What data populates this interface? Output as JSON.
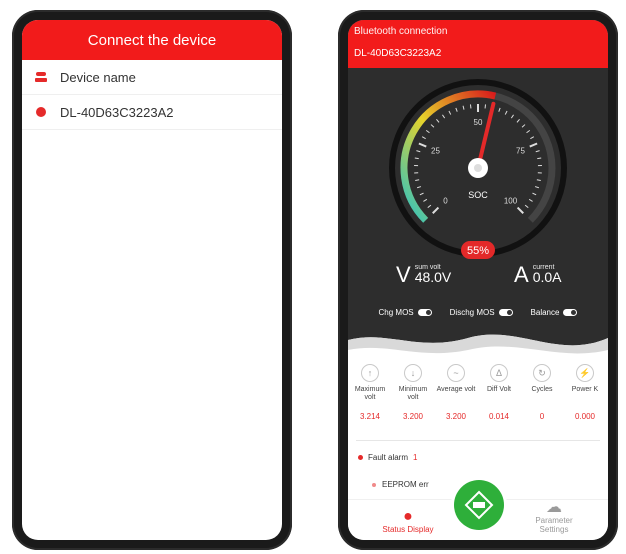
{
  "left_screen": {
    "title": "Connect the device",
    "header_row": {
      "label": "Device name"
    },
    "devices": [
      {
        "name": "DL-40D63C3223A2"
      }
    ]
  },
  "right_screen": {
    "header": {
      "status": "Bluetooth connection",
      "device_id": "DL-40D63C3223A2"
    },
    "gauge": {
      "label": "SOC",
      "value_text": "55%",
      "value": 55,
      "ticks": [
        "0",
        "25",
        "50",
        "75",
        "100"
      ]
    },
    "readouts": [
      {
        "label": "sum volt",
        "value": "48.0V"
      },
      {
        "label": "current",
        "value": "0.0A"
      }
    ],
    "toggles": [
      {
        "label": "Chg MOS"
      },
      {
        "label": "Dischg MOS"
      },
      {
        "label": "Balance"
      }
    ],
    "stats": [
      {
        "name": "Maximum volt",
        "value": "3.214"
      },
      {
        "name": "Minimum volt",
        "value": "3.200"
      },
      {
        "name": "Average volt",
        "value": "3.200"
      },
      {
        "name": "Diff Volt",
        "value": "0.014"
      },
      {
        "name": "Cycles",
        "value": "0"
      },
      {
        "name": "Power K",
        "value": "0.000"
      }
    ],
    "fault": {
      "label": "Fault alarm",
      "count": "1",
      "items": [
        "EEPROM err"
      ]
    },
    "bottom_nav": {
      "left_label": "Status Display",
      "right_label": "Parameter Settings",
      "center_icon": "bms-icon"
    },
    "colors": {
      "accent": "#f21b1b",
      "dark": "#2d2d2d",
      "green": "#2eaf3a"
    }
  }
}
